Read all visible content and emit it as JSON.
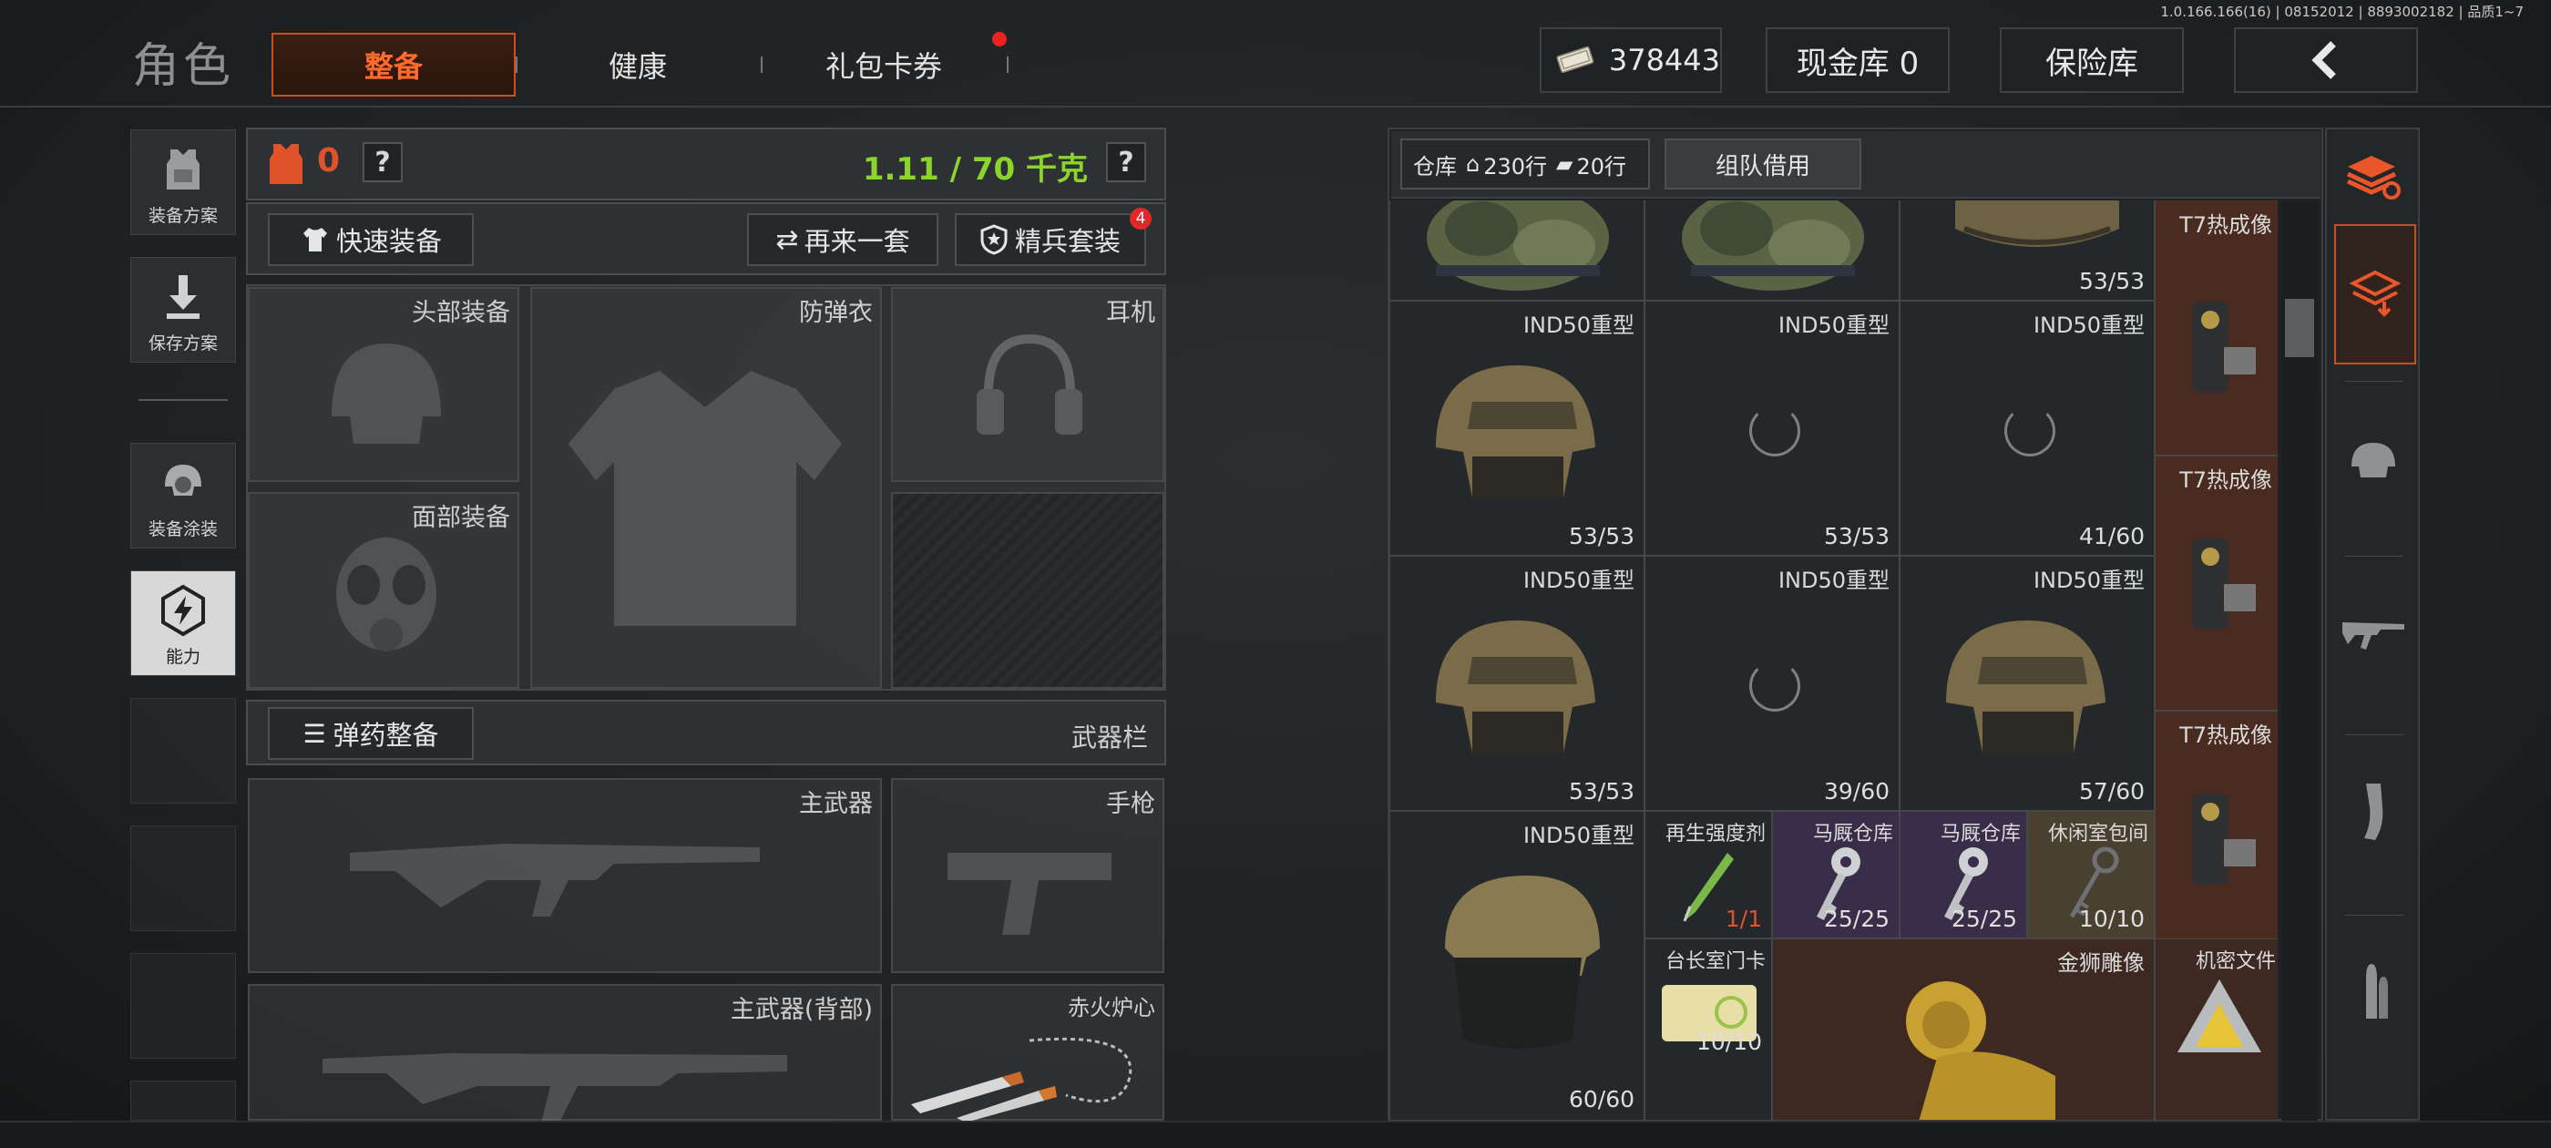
{
  "version": "1.0.166.166(16) | 08152012 | 8893002182 | 品质1~7",
  "page_title": "角色",
  "tabs": [
    {
      "label": "整备",
      "active": true
    },
    {
      "label": "健康",
      "active": false
    },
    {
      "label": "礼包卡券",
      "active": false
    }
  ],
  "header": {
    "currency": "378443",
    "cash_vault": "现金库 0",
    "safe_box": "保险库"
  },
  "left_nav": [
    {
      "label": "装备方案",
      "icon": "vest-icon"
    },
    {
      "label": "保存方案",
      "icon": "download-icon"
    },
    {
      "label": "装备涂装",
      "icon": "helmet-paint-icon"
    },
    {
      "label": "能力",
      "icon": "lightning-hex-icon"
    }
  ],
  "equip": {
    "armor_count": "0",
    "weight": "1.11 / 70 千克",
    "quick_equip": "快速装备",
    "reroll": "再来一套",
    "elite_set": "精兵套装",
    "elite_badge": "4",
    "slots": {
      "head": "头部装备",
      "vest": "防弹衣",
      "headset": "耳机",
      "face": "面部装备"
    },
    "ammo_btn": "弹药整备",
    "weapon_bar": "武器栏",
    "primary": "主武器",
    "pistol": "手枪",
    "primary_back": "主武器(背部)",
    "melee": "赤火炉心"
  },
  "warehouse": {
    "label": "仓库",
    "rows_home": "230行",
    "rows_other": "20行",
    "team_borrow": "组队借用",
    "r0": [
      {
        "name": "",
        "count": ""
      },
      {
        "name": "",
        "count": ""
      },
      {
        "name": "",
        "count": "53/53"
      }
    ],
    "r1": [
      {
        "name": "IND50重型",
        "count": "53/53"
      },
      {
        "name": "IND50重型",
        "count": "53/53"
      },
      {
        "name": "IND50重型",
        "count": "41/60"
      }
    ],
    "r2": [
      {
        "name": "IND50重型",
        "count": "53/53"
      },
      {
        "name": "IND50重型",
        "count": "39/60"
      },
      {
        "name": "IND50重型",
        "count": "57/60"
      }
    ],
    "r3": {
      "name": "IND50重型",
      "count": "60/60"
    },
    "thermal": [
      "T7热成像",
      "T7热成像",
      "T7热成像"
    ],
    "small": [
      {
        "name": "再生强度剂",
        "count": "1/1"
      },
      {
        "name": "马厩仓库",
        "count": "25/25"
      },
      {
        "name": "马厩仓库",
        "count": "25/25"
      },
      {
        "name": "休闲室包间",
        "count": "10/10"
      }
    ],
    "card": {
      "name": "台长室门卡",
      "count": "10/10"
    },
    "lion": {
      "name": "金狮雕像"
    },
    "secret": {
      "name": "机密文件"
    }
  }
}
